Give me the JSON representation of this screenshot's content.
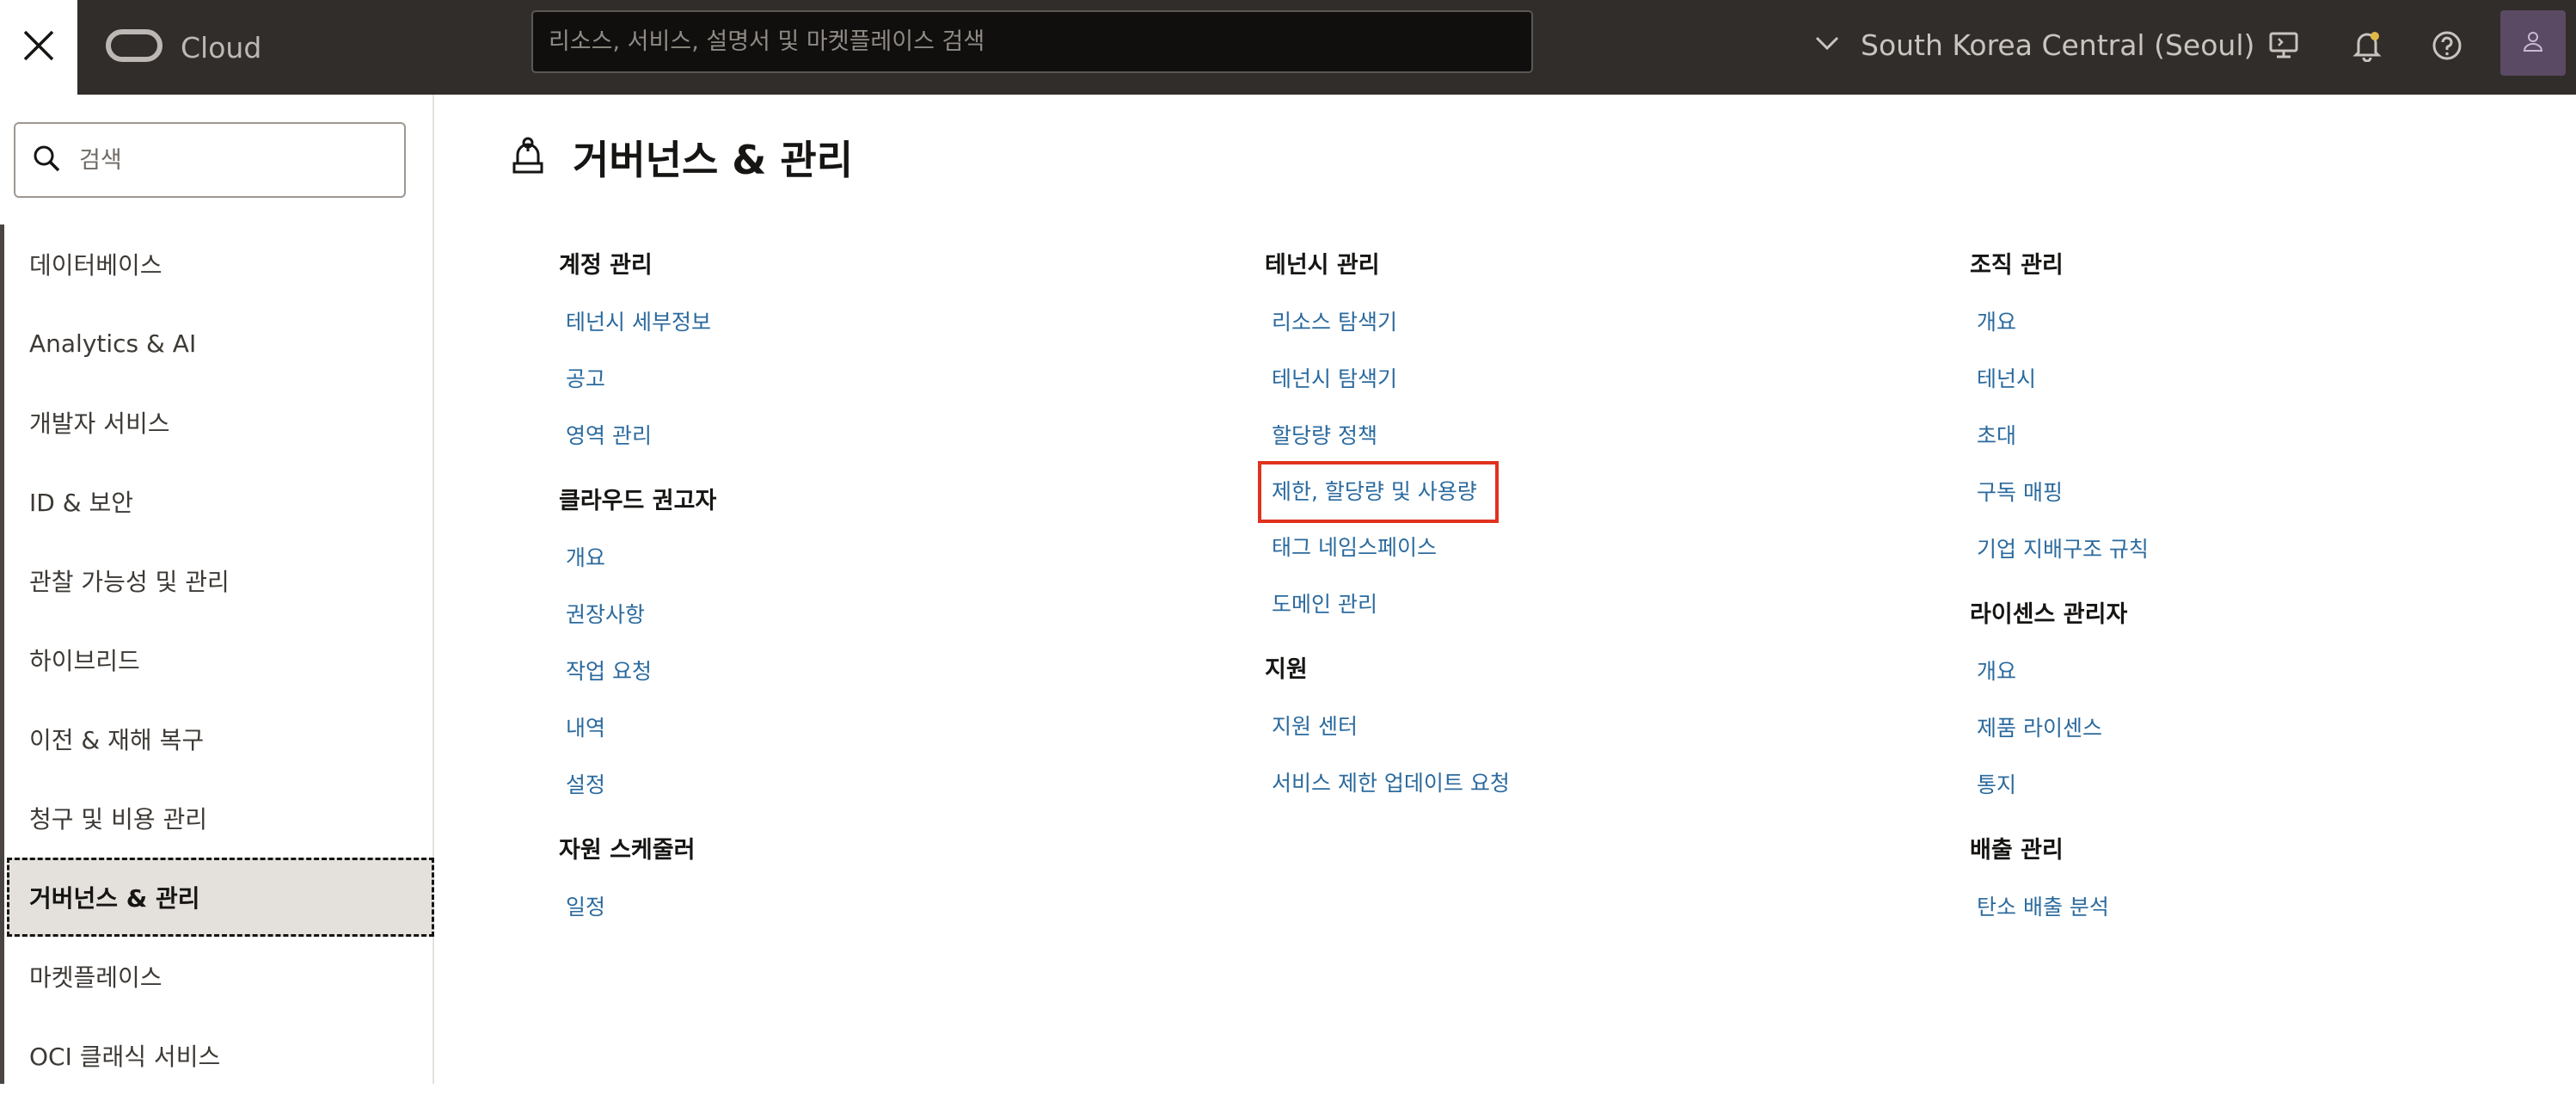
{
  "topbar": {
    "brand": "Cloud",
    "search_placeholder": "리소스, 서비스, 설명서 및 마켓플레이스 검색",
    "region": "South Korea Central (Seoul)"
  },
  "sidebar": {
    "search_placeholder": "검색",
    "items": [
      {
        "label": "데이터베이스"
      },
      {
        "label": "Analytics & AI"
      },
      {
        "label": "개발자 서비스"
      },
      {
        "label": "ID & 보안"
      },
      {
        "label": "관찰 가능성 및 관리"
      },
      {
        "label": "하이브리드"
      },
      {
        "label": "이전 & 재해 복구"
      },
      {
        "label": "청구 및 비용 관리"
      },
      {
        "label": "거버넌스 & 관리"
      },
      {
        "label": "마켓플레이스"
      },
      {
        "label": "OCI 클래식 서비스"
      }
    ],
    "active_index": 8
  },
  "main": {
    "title": "거버넌스 & 관리",
    "columns": [
      {
        "sections": [
          {
            "title": "계정 관리",
            "links": [
              "테넌시 세부정보",
              "공고",
              "영역 관리"
            ]
          },
          {
            "title": "클라우드 권고자",
            "links": [
              "개요",
              "권장사항",
              "작업 요청",
              "내역",
              "설정"
            ]
          },
          {
            "title": "자원 스케줄러",
            "links": [
              "일정"
            ]
          }
        ]
      },
      {
        "sections": [
          {
            "title": "테넌시 관리",
            "links": [
              "리소스 탐색기",
              "테넌시 탐색기",
              "할당량 정책",
              "제한, 할당량 및 사용량",
              "태그 네임스페이스",
              "도메인 관리"
            ]
          },
          {
            "title": "지원",
            "links": [
              "지원 센터",
              "서비스 제한 업데이트 요청"
            ]
          }
        ]
      },
      {
        "sections": [
          {
            "title": "조직 관리",
            "links": [
              "개요",
              "테넌시",
              "초대",
              "구독 매핑",
              "기업 지배구조 규칙"
            ]
          },
          {
            "title": "라이센스 관리자",
            "links": [
              "개요",
              "제품 라이센스",
              "통지"
            ]
          },
          {
            "title": "배출 관리",
            "links": [
              "탄소 배출 분석"
            ]
          }
        ]
      }
    ]
  },
  "colors": {
    "topbar_bg": "#312d2a",
    "link": "#2b6a9e",
    "highlight_box": "#e0321f",
    "active_item_bg": "#e4e1dd"
  }
}
